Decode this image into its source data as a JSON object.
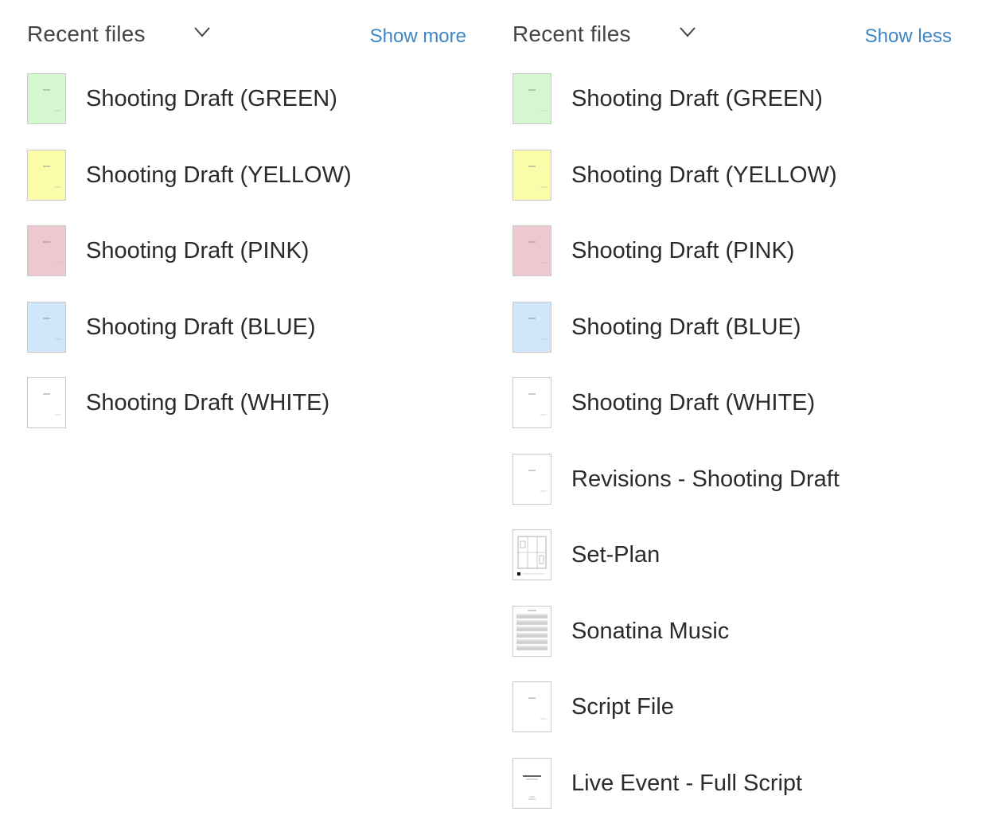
{
  "colors": {
    "link": "#3e86c6",
    "green": "#d5f7cf",
    "yellow": "#fbfca9",
    "pink": "#eec8cf",
    "blue": "#cfe6fb",
    "white": "#ffffff"
  },
  "left_panel": {
    "title": "Recent files",
    "toggle_label": "Show more",
    "files": [
      {
        "name": "Shooting Draft (GREEN)",
        "color": "green",
        "icon": "script-page-icon"
      },
      {
        "name": "Shooting Draft (YELLOW)",
        "color": "yellow",
        "icon": "script-page-icon"
      },
      {
        "name": "Shooting Draft (PINK)",
        "color": "pink",
        "icon": "script-page-icon"
      },
      {
        "name": "Shooting Draft (BLUE)",
        "color": "blue",
        "icon": "script-page-icon"
      },
      {
        "name": "Shooting Draft (WHITE)",
        "color": "white",
        "icon": "script-page-icon"
      }
    ]
  },
  "right_panel": {
    "title": "Recent files",
    "toggle_label": "Show less",
    "files": [
      {
        "name": "Shooting Draft (GREEN)",
        "color": "green",
        "icon": "script-page-icon"
      },
      {
        "name": "Shooting Draft (YELLOW)",
        "color": "yellow",
        "icon": "script-page-icon"
      },
      {
        "name": "Shooting Draft (PINK)",
        "color": "pink",
        "icon": "script-page-icon"
      },
      {
        "name": "Shooting Draft (BLUE)",
        "color": "blue",
        "icon": "script-page-icon"
      },
      {
        "name": "Shooting Draft (WHITE)",
        "color": "white",
        "icon": "script-page-icon"
      },
      {
        "name": "Revisions - Shooting Draft",
        "color": "white",
        "icon": "script-page-icon"
      },
      {
        "name": "Set-Plan",
        "color": "white",
        "icon": "floor-plan-icon"
      },
      {
        "name": "Sonatina Music",
        "color": "white",
        "icon": "sheet-music-icon"
      },
      {
        "name": "Script File",
        "color": "white",
        "icon": "script-page-icon"
      },
      {
        "name": "Live Event - Full Script",
        "color": "white",
        "icon": "title-page-icon"
      }
    ]
  }
}
